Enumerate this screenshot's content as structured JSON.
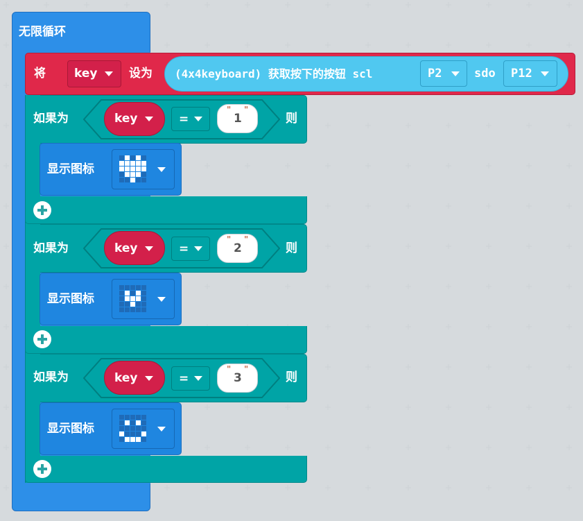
{
  "loop": {
    "label": "无限循环"
  },
  "set_block": {
    "keyword": "将",
    "variable": "key",
    "set_to": "设为",
    "call": {
      "prefix": "(4x4keyboard) 获取按下的按钮 scl",
      "scl": "P2",
      "sdo_label": "sdo",
      "sdo": "P12"
    }
  },
  "if_blocks": [
    {
      "if_label": "如果为",
      "variable": "key",
      "operator": "=",
      "value": "1",
      "then_label": "则",
      "show_label": "显示图标",
      "icon": [
        [
          0,
          1,
          0,
          1,
          0
        ],
        [
          1,
          1,
          1,
          1,
          1
        ],
        [
          1,
          1,
          1,
          1,
          1
        ],
        [
          0,
          1,
          1,
          1,
          0
        ],
        [
          0,
          0,
          1,
          0,
          0
        ]
      ]
    },
    {
      "if_label": "如果为",
      "variable": "key",
      "operator": "=",
      "value": "2",
      "then_label": "则",
      "show_label": "显示图标",
      "icon": [
        [
          0,
          0,
          0,
          0,
          0
        ],
        [
          0,
          1,
          0,
          1,
          0
        ],
        [
          0,
          1,
          1,
          1,
          0
        ],
        [
          0,
          0,
          1,
          0,
          0
        ],
        [
          0,
          0,
          0,
          0,
          0
        ]
      ]
    },
    {
      "if_label": "如果为",
      "variable": "key",
      "operator": "=",
      "value": "3",
      "then_label": "则",
      "show_label": "显示图标",
      "icon": [
        [
          0,
          0,
          0,
          0,
          0
        ],
        [
          0,
          1,
          0,
          1,
          0
        ],
        [
          0,
          0,
          0,
          0,
          0
        ],
        [
          1,
          0,
          0,
          0,
          1
        ],
        [
          0,
          1,
          1,
          1,
          0
        ]
      ]
    }
  ],
  "colors": {
    "loop": "#2d8fe8",
    "set": "#e0284a",
    "if": "#00a4a6",
    "variable": "#d3204a",
    "call": "#50c8f0",
    "basic": "#1f86e0"
  }
}
